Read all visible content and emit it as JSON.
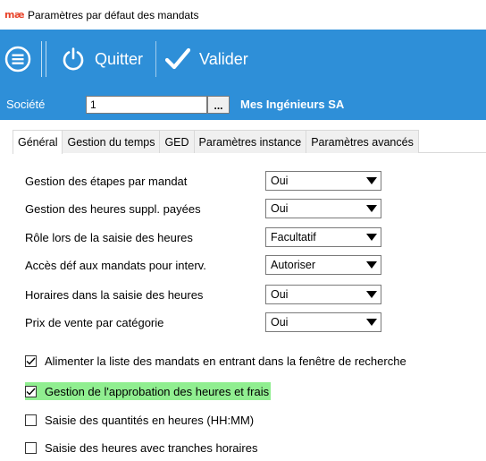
{
  "window": {
    "logo": "mæ",
    "title": "Paramètres par défaut des mandats"
  },
  "toolbar": {
    "menu_icon": "menu-circle-icon",
    "quit_label": "Quitter",
    "quit_icon": "power-icon",
    "validate_label": "Valider",
    "validate_icon": "checkmark-icon",
    "background_color": "#2e8fd8"
  },
  "societe": {
    "label": "Société",
    "value": "1",
    "browse_label": "...",
    "name": "Mes Ingénieurs SA"
  },
  "tabs": [
    {
      "label": "Général",
      "active": true
    },
    {
      "label": "Gestion du temps",
      "active": false
    },
    {
      "label": "GED",
      "active": false
    },
    {
      "label": "Paramètres instance",
      "active": false
    },
    {
      "label": "Paramètres avancés",
      "active": false
    }
  ],
  "fields": [
    {
      "label": "Gestion des étapes par mandat",
      "value": "Oui"
    },
    {
      "label": "Gestion des heures suppl. payées",
      "value": "Oui"
    },
    {
      "label": "Rôle lors de la saisie des heures",
      "value": "Facultatif"
    },
    {
      "label": "Accès déf aux mandats pour interv.",
      "value": "Autoriser"
    },
    {
      "label": "Horaires dans la saisie des heures",
      "value": "Oui"
    },
    {
      "label": "Prix de vente par catégorie",
      "value": "Oui"
    }
  ],
  "checkboxes": [
    {
      "label": "Alimenter la liste des mandats en entrant dans la fenêtre de recherche",
      "checked": true,
      "highlighted": false
    },
    {
      "label": "Gestion de l'approbation des heures et frais",
      "checked": true,
      "highlighted": true
    },
    {
      "label": "Saisie des quantités en heures (HH:MM)",
      "checked": false,
      "highlighted": false
    },
    {
      "label": "Saisie des heures avec tranches horaires",
      "checked": false,
      "highlighted": false
    }
  ],
  "colors": {
    "accent": "#2e8fd8",
    "highlight": "#90ee90",
    "logo": "#e8452c"
  }
}
